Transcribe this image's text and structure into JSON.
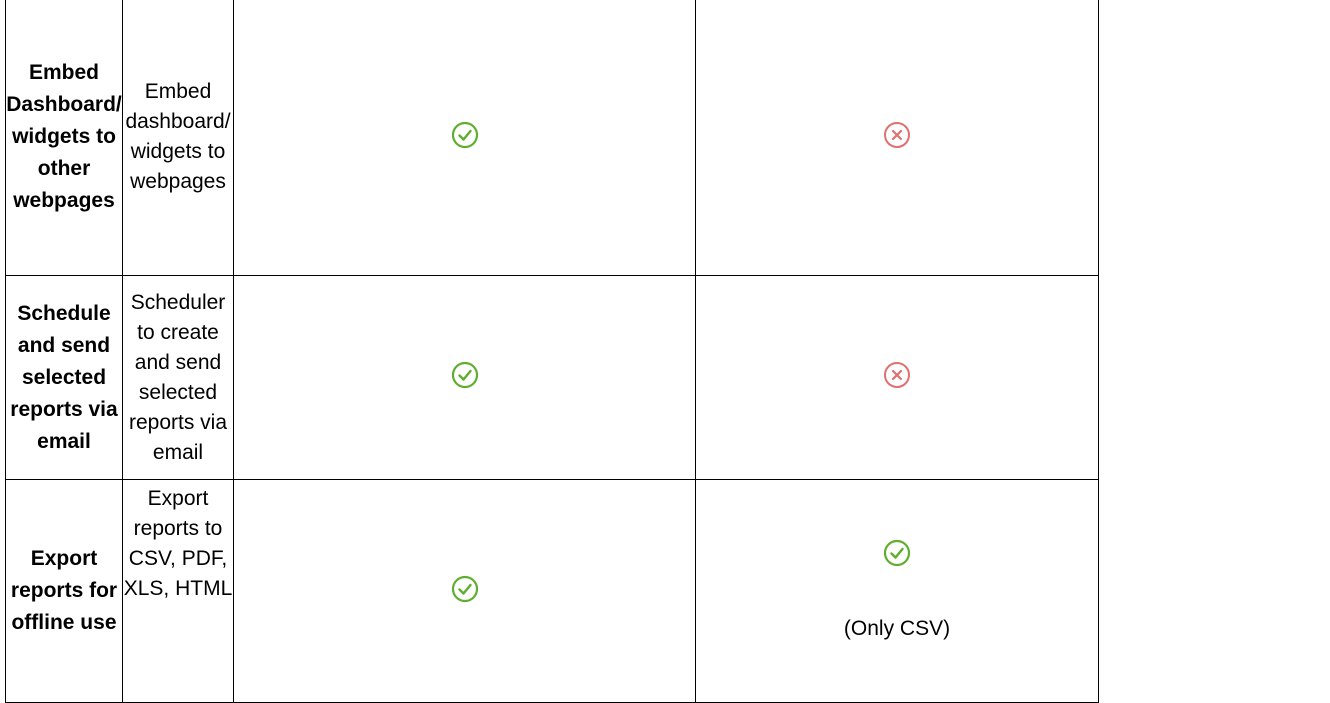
{
  "rows": [
    {
      "feature": "Embed Dashboard/ widgets to other webpages",
      "description": "Embed dashboard/ widgets to webpages",
      "col3_icon": "check-circle-icon",
      "col4_icon": "x-circle-icon",
      "col4_note": ""
    },
    {
      "feature": "Schedule and send selected reports via email",
      "description": "Scheduler to create and send selected reports via email",
      "col3_icon": "check-circle-icon",
      "col4_icon": "x-circle-icon",
      "col4_note": ""
    },
    {
      "feature": "Export reports for offline use",
      "description": "Export reports to CSV, PDF, XLS, HTML",
      "col3_icon": "check-circle-icon",
      "col4_icon": "check-circle-icon",
      "col4_note": "(Only CSV)"
    }
  ],
  "colors": {
    "check": "#5fae2e",
    "cross": "#e07070",
    "border": "#000000"
  }
}
